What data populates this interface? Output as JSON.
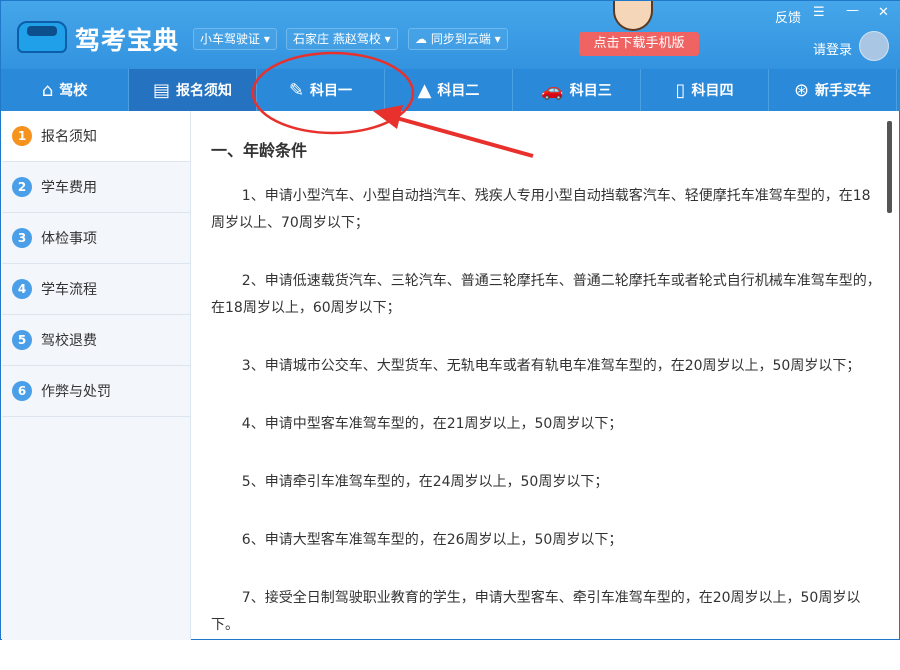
{
  "app": {
    "title": "驾考宝典",
    "license_select": "小车驾驶证",
    "school_select": "石家庄 燕赵驾校",
    "sync_button": "同步到云端",
    "download_button": "点击下载手机版",
    "feedback": "反馈",
    "login": "请登录"
  },
  "nav": [
    {
      "label": "驾校",
      "icon": "⌂"
    },
    {
      "label": "报名须知",
      "icon": "▤"
    },
    {
      "label": "科目一",
      "icon": "✎"
    },
    {
      "label": "科目二",
      "icon": "▲"
    },
    {
      "label": "科目三",
      "icon": "🚗"
    },
    {
      "label": "科目四",
      "icon": "▯"
    },
    {
      "label": "新手买车",
      "icon": "⊛"
    }
  ],
  "sidebar": [
    {
      "n": "1",
      "label": "报名须知"
    },
    {
      "n": "2",
      "label": "学车费用"
    },
    {
      "n": "3",
      "label": "体检事项"
    },
    {
      "n": "4",
      "label": "学车流程"
    },
    {
      "n": "5",
      "label": "驾校退费"
    },
    {
      "n": "6",
      "label": "作弊与处罚"
    }
  ],
  "content": {
    "heading": "一、年龄条件",
    "paragraphs": [
      "1、申请小型汽车、小型自动挡汽车、残疾人专用小型自动挡载客汽车、轻便摩托车准驾车型的，在18周岁以上、70周岁以下；",
      "2、申请低速载货汽车、三轮汽车、普通三轮摩托车、普通二轮摩托车或者轮式自行机械车准驾车型的，在18周岁以上，60周岁以下；",
      "3、申请城市公交车、大型货车、无轨电车或者有轨电车准驾车型的，在20周岁以上，50周岁以下；",
      "4、申请中型客车准驾车型的，在21周岁以上，50周岁以下；",
      "5、申请牵引车准驾车型的，在24周岁以上，50周岁以下；",
      "6、申请大型客车准驾车型的，在26周岁以上，50周岁以下；",
      "7、接受全日制驾驶职业教育的学生，申请大型客车、牵引车准驾车型的，在20周岁以上，50周岁以下。"
    ]
  },
  "colors": {
    "header": "#3393df",
    "annotation": "#e8302c"
  }
}
